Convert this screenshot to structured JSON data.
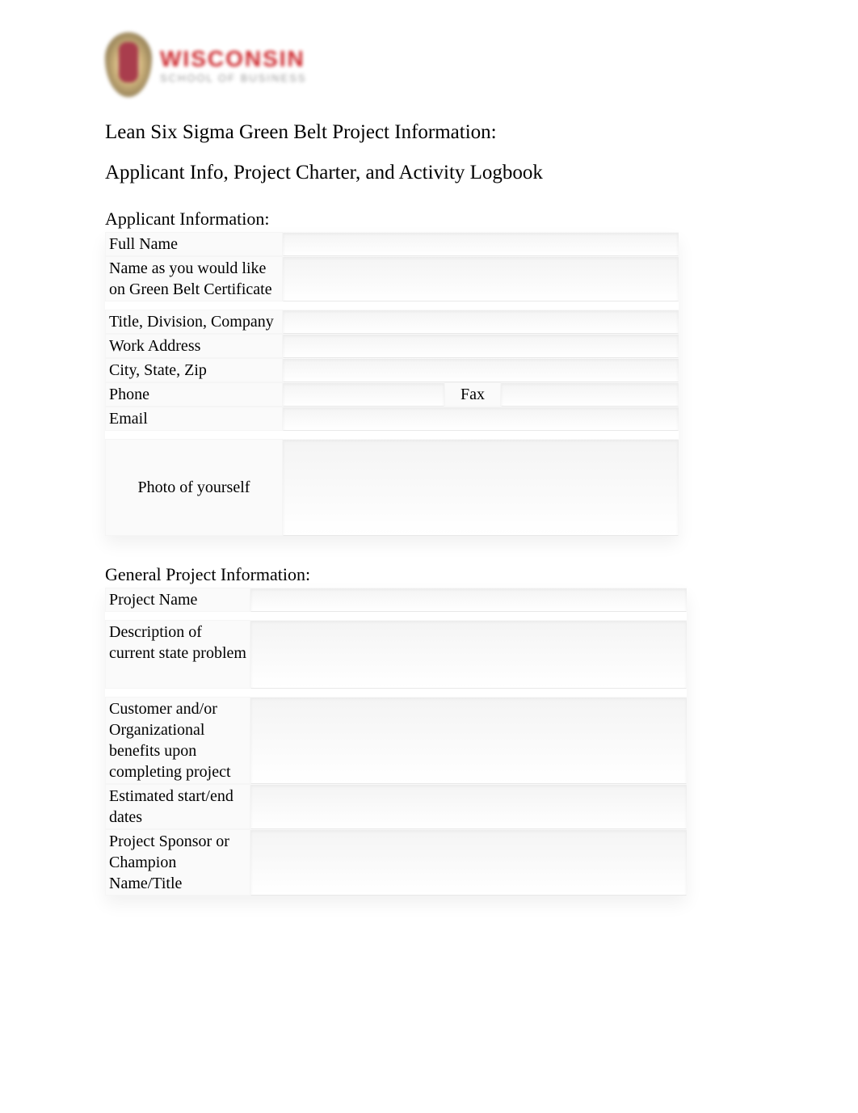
{
  "logo": {
    "main": "WISCONSIN",
    "sub": "SCHOOL OF BUSINESS"
  },
  "titles": {
    "main": "Lean Six Sigma Green Belt Project Information:",
    "sub": "Applicant Info, Project Charter, and Activity Logbook"
  },
  "applicant": {
    "heading": "Applicant Information:",
    "rows": {
      "full_name": "Full Name",
      "cert_name": "Name as you would like on Green Belt Certificate",
      "title_company": "Title, Division, Company",
      "work_address": "Work Address",
      "city_state_zip": "City, State, Zip",
      "phone": "Phone",
      "fax": "Fax",
      "email": "Email",
      "photo": "Photo of yourself"
    },
    "values": {
      "full_name": "",
      "cert_name": "",
      "title_company": "",
      "work_address": "",
      "city_state_zip": "",
      "phone": "",
      "fax": "",
      "email": "",
      "photo": ""
    }
  },
  "project": {
    "heading": "General Project Information:",
    "rows": {
      "project_name": "Project Name",
      "description": "Description of current state problem",
      "benefits": "Customer and/or Organizational benefits upon completing project",
      "dates": "Estimated start/end dates",
      "sponsor": "Project Sponsor or Champion Name/Title"
    },
    "values": {
      "project_name": "",
      "description": "",
      "benefits": "",
      "dates": "",
      "sponsor": ""
    }
  }
}
